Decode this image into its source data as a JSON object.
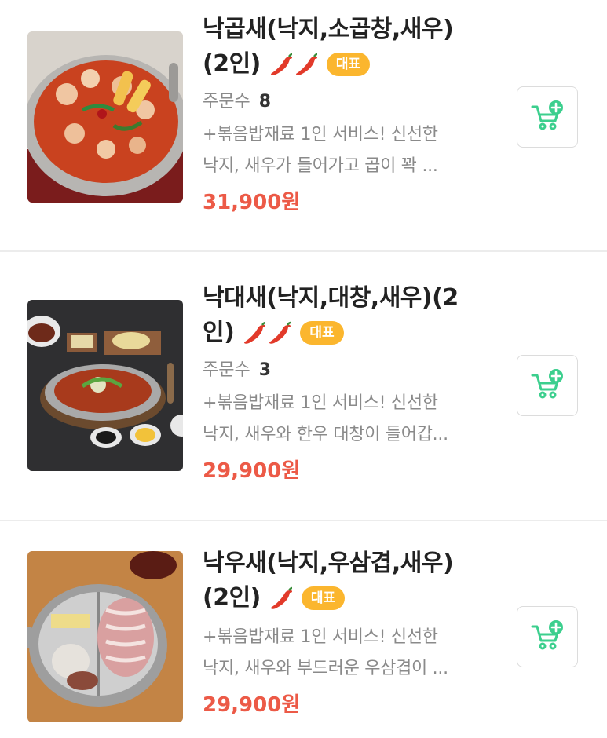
{
  "items": [
    {
      "title_line1": "낙곱새(낙지,소곱창,새우)",
      "title_line2": "(2인)",
      "pepper_icons": [
        "chili-pepper-icon",
        "chili-pepper-icon"
      ],
      "badge": "대표",
      "orders_label": "주문수",
      "orders_count": "8",
      "desc_line1": "+볶음밥재료 1인 서비스! 신선한",
      "desc_line2": "낙지, 새우가 들어가고 곱이 꽉 ...",
      "price": "31,900원"
    },
    {
      "title_line1": "낙대새(낙지,대창,새우)(2",
      "title_line2": "인)",
      "pepper_icons": [
        "chili-pepper-icon",
        "chili-pepper-icon"
      ],
      "badge": "대표",
      "orders_label": "주문수",
      "orders_count": "3",
      "desc_line1": "+볶음밥재료 1인 서비스! 신선한",
      "desc_line2": "낙지, 새우와 한우 대창이 들어갑...",
      "price": "29,900원"
    },
    {
      "title_line1": "낙우새(낙지,우삼겹,새우)",
      "title_line2": "(2인)",
      "pepper_icons": [
        "chili-pepper-icon"
      ],
      "badge": "대표",
      "desc_line1": "+볶음밥재료 1인 서비스! 신선한",
      "desc_line2": "낙지, 새우와 부드러운 우삼겹이 ...",
      "price": "29,900원"
    }
  ],
  "colors": {
    "price": "#ec5a47",
    "badge": "#fbb62e",
    "cart_icon": "#3ccf8e",
    "pepper": "#e23a2a"
  },
  "icons": {
    "cart": "cart-add-icon"
  }
}
